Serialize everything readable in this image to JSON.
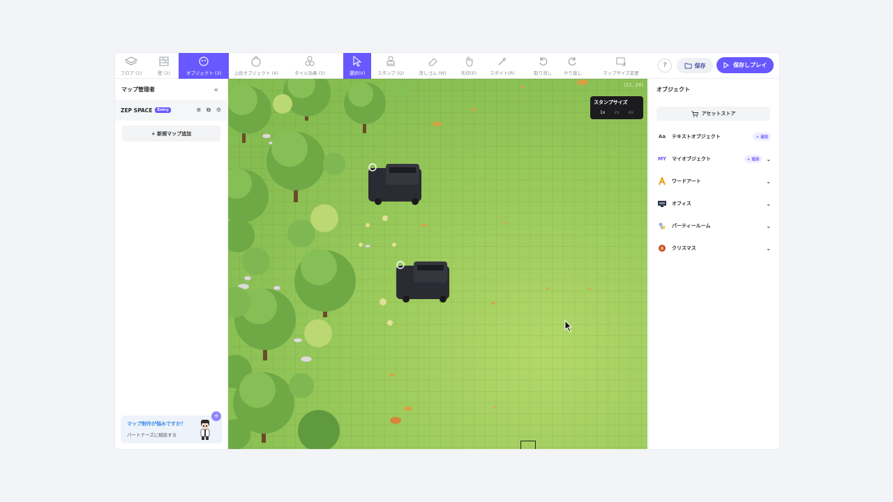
{
  "toolbar": {
    "tools": [
      {
        "label": "フロア (1)",
        "icon": "layers-icon"
      },
      {
        "label": "壁 (2)",
        "icon": "wall-icon"
      },
      {
        "label": "オブジェクト (3)",
        "icon": "object-icon"
      },
      {
        "label": "上段オブジェクト (4)",
        "icon": "upper-object-icon"
      },
      {
        "label": "タイル効果 (5)",
        "icon": "tile-effect-icon"
      },
      {
        "label": "選択(V)",
        "icon": "cursor-select-icon"
      },
      {
        "label": "スタンプ (Q)",
        "icon": "stamp-icon"
      },
      {
        "label": "消しゴム (W)",
        "icon": "eraser-icon"
      },
      {
        "label": "矢印(E)",
        "icon": "hand-icon"
      },
      {
        "label": "スポイト(R)",
        "icon": "eyedropper-icon"
      },
      {
        "label": "取り消し",
        "icon": "undo-icon"
      },
      {
        "label": "やり直し",
        "icon": "redo-icon"
      },
      {
        "label": "マップサイズ変更",
        "icon": "resize-map-icon"
      }
    ],
    "help_glyph": "?",
    "save_label": "保存",
    "save_play_label": "保存しプレイ"
  },
  "left_panel": {
    "title": "マップ管理者",
    "collapse_glyph": "«",
    "space_name": "ZEP SPACE",
    "space_badge": "Entry",
    "add_map_label": "+ 新規マップ追加",
    "help_title": "マップ制作が悩みですか？",
    "help_subtitle": "パートナーズに相談する",
    "help_plus": "+"
  },
  "map": {
    "coords": "(21, 24)",
    "stamp_size": {
      "title": "スタンプサイズ",
      "options": [
        "1x",
        "2x",
        "4x"
      ],
      "selected": "1x"
    }
  },
  "right_panel": {
    "title": "オブジェクト",
    "asset_store_label": "アセットストア",
    "categories": [
      {
        "label": "テキストオブジェクト",
        "icon_text": "Aa",
        "add": "+ 追加",
        "chevron": ""
      },
      {
        "label": "マイオブジェクト",
        "icon_text": "MY",
        "add": "+ 追加",
        "chevron": "⌄"
      },
      {
        "label": "ワードアート",
        "icon_text": "",
        "add": "",
        "chevron": "⌄"
      },
      {
        "label": "オフィス",
        "icon_text": "",
        "add": "",
        "chevron": "⌄"
      },
      {
        "label": "パーティールーム",
        "icon_text": "",
        "add": "",
        "chevron": "⌄"
      },
      {
        "label": "クリスマス",
        "icon_text": "",
        "add": "",
        "chevron": "⌄"
      }
    ]
  },
  "colors": {
    "accent": "#6758ff",
    "map_grass": "#9bcb5c",
    "tree_dark": "#5c9a3c",
    "tree_light": "#8cc25a"
  }
}
